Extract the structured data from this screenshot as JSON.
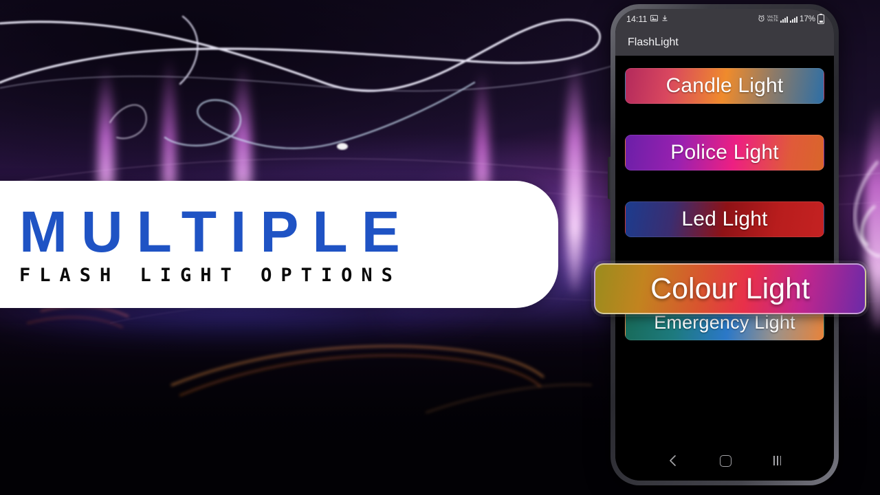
{
  "banner": {
    "headline": "MULTIPLE",
    "subline": "FLASH  LIGHT  OPTIONS",
    "headline_color": "#1f53c4",
    "background_color": "#ffffff"
  },
  "phone": {
    "statusbar": {
      "time": "14:11",
      "left_icons": [
        "image-icon",
        "download-icon"
      ],
      "alarm_icon": "alarm-icon",
      "network_label": "VoLTE",
      "signal_icons": [
        "signal-bars-sim1",
        "signal-bars-sim2"
      ],
      "battery_percent": "17%",
      "battery_icon": "battery-icon"
    },
    "appbar": {
      "title": "FlashLight"
    },
    "buttons": [
      {
        "label": "Candle Light",
        "name": "candle-light-button",
        "selected": false
      },
      {
        "label": "Police Light",
        "name": "police-light-button",
        "selected": false
      },
      {
        "label": "Led Light",
        "name": "led-light-button",
        "selected": false
      },
      {
        "label": "Colour Light",
        "name": "colour-light-button",
        "selected": true
      },
      {
        "label": "Emergency Light",
        "name": "emergency-light-button",
        "selected": false
      }
    ],
    "navbar": {
      "back": "back-icon",
      "home": "home-icon",
      "recents": "recents-icon"
    }
  },
  "colors": {
    "accent_blue": "#1f53c4",
    "appbar_gray": "#3b3a40",
    "screen_black": "#000000"
  }
}
